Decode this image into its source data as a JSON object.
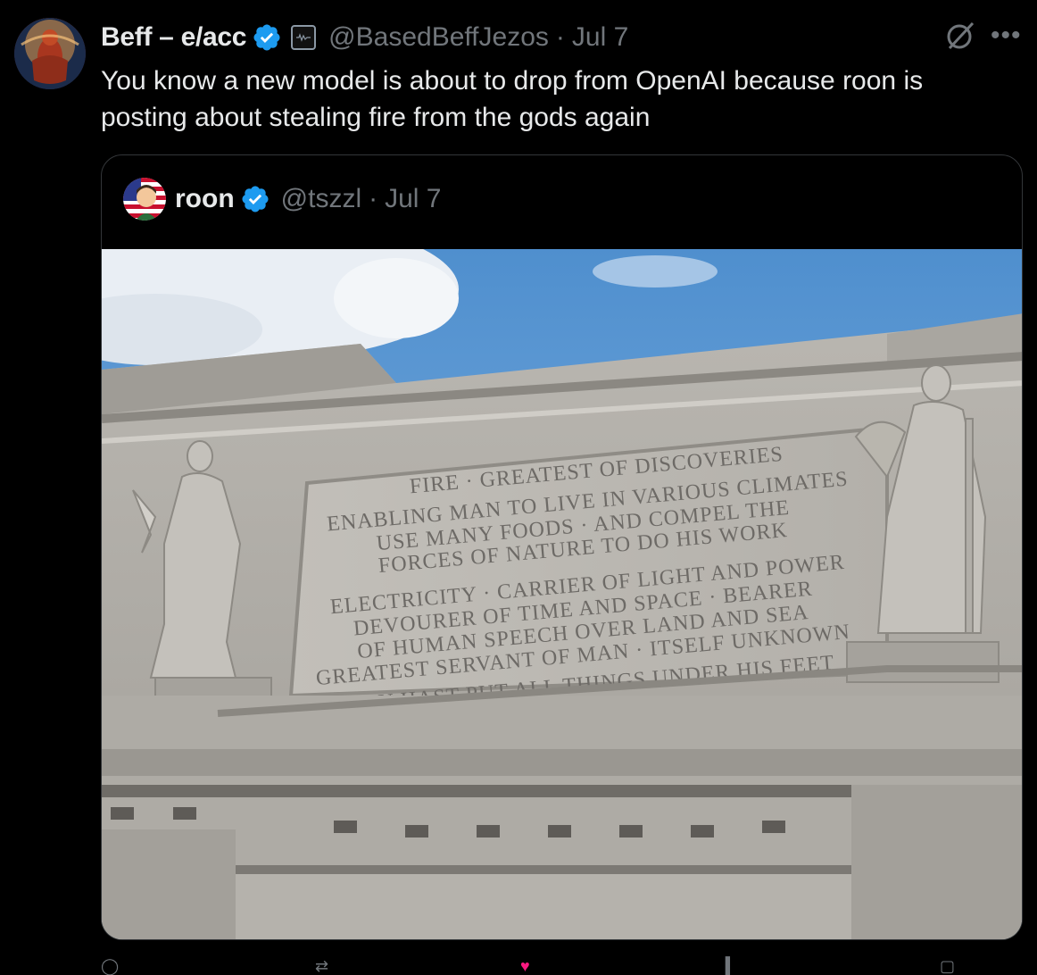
{
  "post": {
    "author_name": "Beff – e/acc",
    "author_handle": "@BasedBeffJezos",
    "separator": "·",
    "date": "Jul 7",
    "text": "You know a new model is about to drop from OpenAI because roon is posting about stealing fire from the gods again"
  },
  "quoted_post": {
    "author_name": "roon",
    "author_handle": "@tszzl",
    "separator": "·",
    "date": "Jul 7",
    "inscription_lines": [
      "FIRE · GREATEST OF DISCOVERIES",
      "ENABLING MAN TO LIVE IN VARIOUS CLIMATES",
      "USE MANY FOODS · AND COMPEL THE",
      "FORCES OF NATURE TO DO HIS WORK",
      "ELECTRICITY · CARRIER OF LIGHT AND POWER",
      "DEVOURER OF TIME AND SPACE · BEARER",
      "OF HUMAN SPEECH OVER LAND AND SEA",
      "GREATEST SERVANT OF MAN · ITSELF UNKNOWN",
      "THOU HAST PUT ALL THINGS UNDER HIS FEET"
    ]
  },
  "icons": {
    "verified": "verified-badge-icon",
    "affiliation": "affiliation-badge-icon",
    "grok": "grok-icon",
    "more": "more-icon"
  },
  "colors": {
    "background": "#000000",
    "text": "#e7e9ea",
    "secondary": "#71767b",
    "verified_blue": "#1d9bf0",
    "border": "#333639"
  }
}
